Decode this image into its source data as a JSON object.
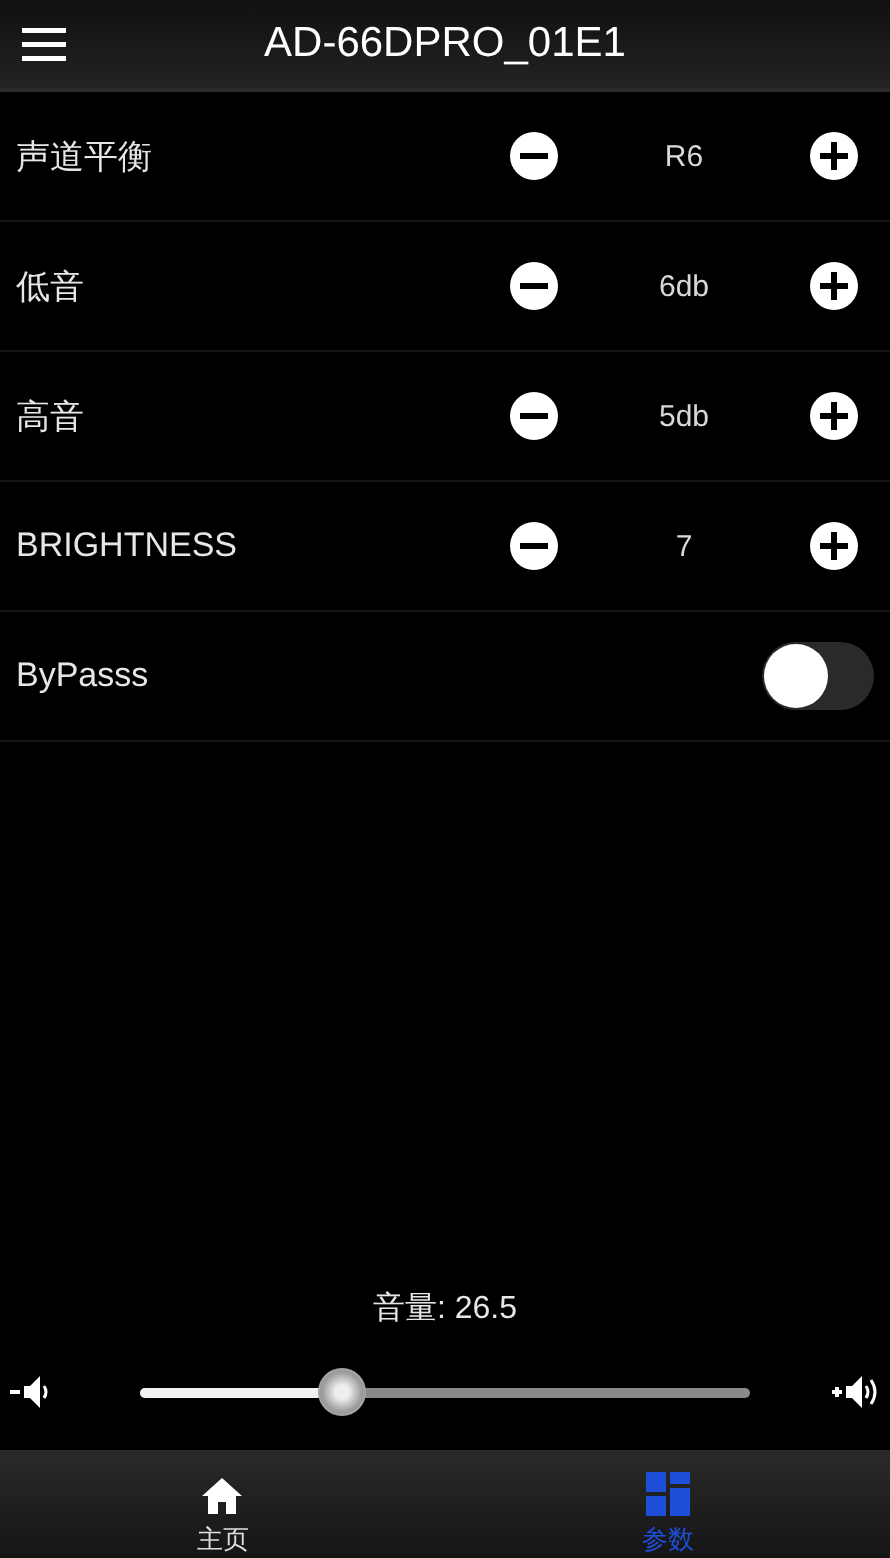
{
  "header": {
    "title": "AD-66DPRO_01E1"
  },
  "settings": [
    {
      "kind": "stepper",
      "label": "声道平衡",
      "value": "R6"
    },
    {
      "kind": "stepper",
      "label": "低音",
      "value": "6db"
    },
    {
      "kind": "stepper",
      "label": "高音",
      "value": "5db"
    },
    {
      "kind": "stepper",
      "label": "BRIGHTNESS",
      "value": "7"
    },
    {
      "kind": "toggle",
      "label": "ByPasss",
      "on": false
    }
  ],
  "volume": {
    "label": "音量: 26.5",
    "level": 0.33
  },
  "tabs": [
    {
      "label": "主页",
      "kind": "home",
      "selected": false
    },
    {
      "label": "参数",
      "kind": "grid",
      "selected": true
    }
  ]
}
